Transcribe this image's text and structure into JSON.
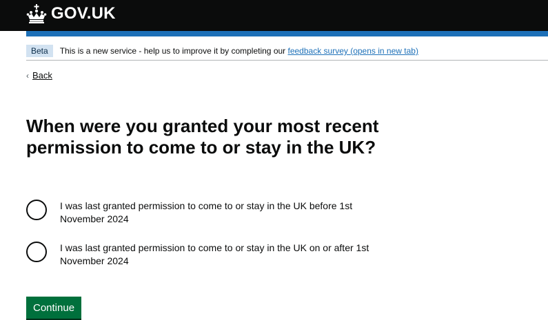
{
  "header": {
    "logo_text": "GOV.UK"
  },
  "phase_banner": {
    "tag": "Beta",
    "text": "This is a new service - help us to improve it by completing our ",
    "link_text": "feedback survey (opens in new tab)"
  },
  "back_link": {
    "label": "Back"
  },
  "question": {
    "title": "When were you granted your most recent permission to come to or stay in the UK?"
  },
  "options": [
    {
      "label": "I was last granted permission to come to or stay in the UK before 1st November 2024"
    },
    {
      "label": "I was last granted permission to come to or stay in the UK on or after 1st November 2024"
    }
  ],
  "continue_button": {
    "label": "Continue"
  },
  "colors": {
    "header_bg": "#0b0c0c",
    "brand_blue": "#1d70b8",
    "button_green": "#00703c",
    "tag_bg": "#d2e2f1"
  },
  "icons": {
    "logo": "crown-icon",
    "back": "chevron-left-icon"
  }
}
